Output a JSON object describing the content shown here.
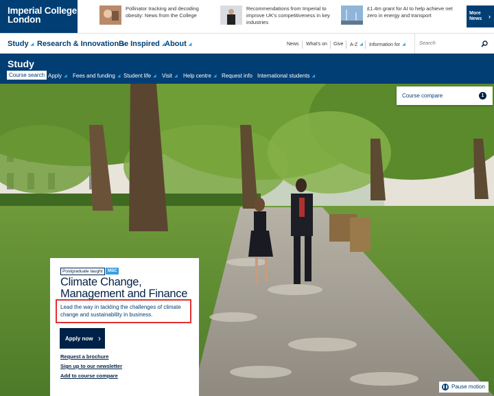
{
  "brand": {
    "line1": "Imperial College",
    "line2": "London"
  },
  "news": [
    {
      "text": "Pollinator tracking and decoding obesity: News from the College"
    },
    {
      "text": "Recommendations from Imperial to improve UK's competitiveness in key industries"
    },
    {
      "text": "£1.4m grant for AI to help achieve net zero in energy and transport"
    }
  ],
  "more_news": {
    "line1": "More",
    "line2": "News"
  },
  "main_nav": [
    "Study",
    "Research & Innovation",
    "Be Inspired",
    "About"
  ],
  "utility_nav": [
    "News",
    "What's on",
    "Give",
    "A-Z",
    "Information for"
  ],
  "search": {
    "placeholder": "Search"
  },
  "section": {
    "title": "Study"
  },
  "sub_nav": [
    "Course search",
    "Apply",
    "Fees and funding",
    "Student life",
    "Visit",
    "Help centre",
    "Request info",
    "International students"
  ],
  "course_compare": {
    "label": "Course compare",
    "count": "1"
  },
  "course": {
    "level": "Postgraduate taught",
    "degree": "MSC",
    "title": "Climate Change, Management and Finance",
    "lead": "Lead the way in tackling the challenges of climate change and sustainability in business.",
    "apply_label": "Apply now",
    "links": [
      "Request a brochure",
      "Sign up to our newsletter",
      "Add to course compare"
    ]
  },
  "pause": {
    "label": "Pause motion"
  },
  "colors": {
    "navy": "#003E74",
    "dark_navy": "#002147",
    "accent": "#3aa0e0",
    "highlight": "#e03030"
  }
}
